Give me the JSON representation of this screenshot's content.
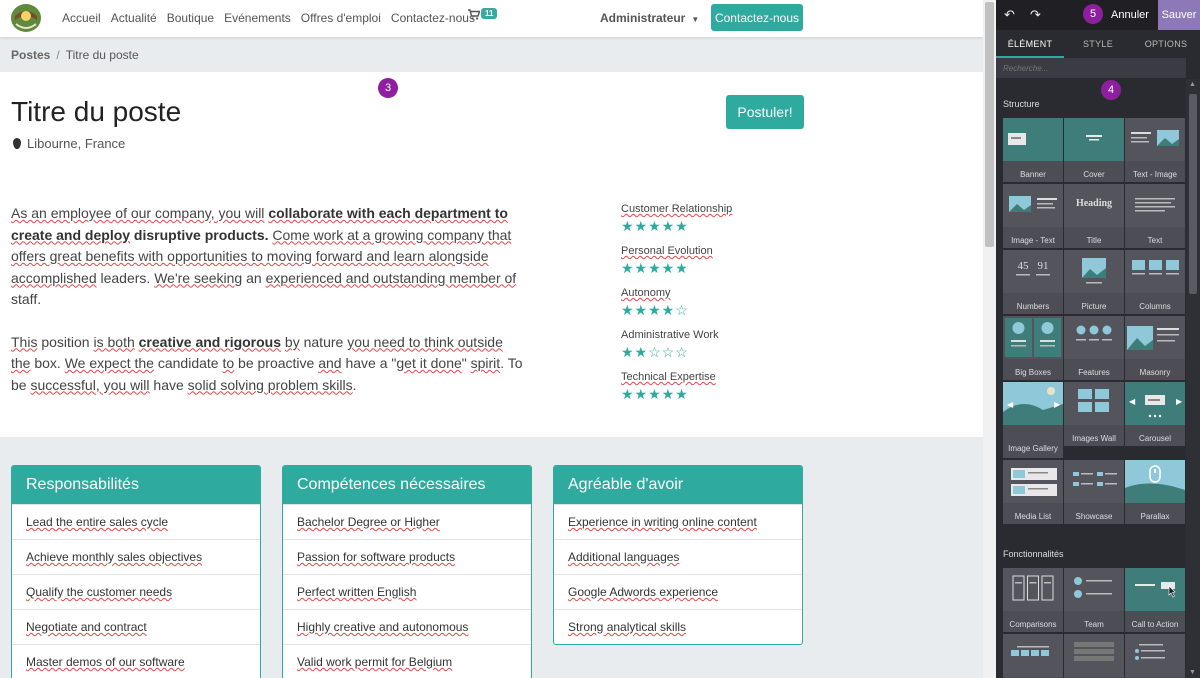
{
  "nav": {
    "links": [
      "Accueil",
      "Actualité",
      "Boutique",
      "Evénements",
      "Offres d'emploi",
      "Contactez-nous"
    ],
    "cart_count": "11",
    "user": "Administrateur",
    "cta": "Contactez-nous"
  },
  "breadcrumb": {
    "root": "Postes",
    "current": "Titre du poste"
  },
  "job": {
    "title": "Titre du poste",
    "location": "Libourne, France",
    "apply": "Postuler!"
  },
  "description": {
    "p1": "As an employee of our company, you will collaborate with each department to create and deploy disruptive products. Come work at a growing company that offers great benefits with opportunities to moving forward and learn alongside accomplished leaders. We're seeking an experienced and outstanding member of staff.",
    "p2": "This position is both creative and rigorous by nature you need to think outside the box. We expect the candidate to be proactive and have a \"get it done\" spirit. To be successful, you will have solid solving problem skills."
  },
  "skills": [
    {
      "name": "Customer Relationship",
      "rating": 5
    },
    {
      "name": "Personal Evolution",
      "rating": 5
    },
    {
      "name": "Autonomy",
      "rating": 4
    },
    {
      "name": "Administrative Work",
      "rating": 2
    },
    {
      "name": "Technical Expertise",
      "rating": 5
    }
  ],
  "cards": [
    {
      "title": "Responsabilités",
      "items": [
        "Lead the entire sales cycle",
        "Achieve monthly sales objectives",
        "Qualify the customer needs",
        "Negotiate and contract",
        "Master demos of our software"
      ]
    },
    {
      "title": "Compétences nécessaires",
      "items": [
        "Bachelor Degree or Higher",
        "Passion for software products",
        "Perfect written English",
        "Highly creative and autonomous",
        "Valid work permit for Belgium"
      ]
    },
    {
      "title": "Agréable d'avoir",
      "items": [
        "Experience in writing online content",
        "Additional languages",
        "Google Adwords experience",
        "Strong analytical skills"
      ]
    }
  ],
  "markers": [
    "3",
    "4",
    "5"
  ],
  "editor": {
    "cancel": "Annuler",
    "save": "Sauver",
    "tabs": [
      "ÉLÉMENT",
      "STYLE",
      "OPTIONS"
    ],
    "search_placeholder": "Recherche...",
    "structure_title": "Structure",
    "structure_blocks": [
      "Banner",
      "Cover",
      "Text - Image",
      "Image - Text",
      "Title",
      "Text",
      "Numbers",
      "Picture",
      "Columns",
      "Big Boxes",
      "Features",
      "Masonry",
      "Image Gallery",
      "Images Wall",
      "Carousel",
      "Media List",
      "Showcase",
      "Parallax"
    ],
    "heading_thumb": "Heading",
    "numbers_thumb": [
      "45",
      "91"
    ],
    "features_title": "Fonctionnalités",
    "feature_blocks": [
      "Comparisons",
      "Team",
      "Call to Action"
    ]
  },
  "colors": {
    "accent": "#2eaa9f",
    "save": "#8d79b8",
    "marker": "#8e1f9e",
    "panel": "#2a2a31"
  }
}
